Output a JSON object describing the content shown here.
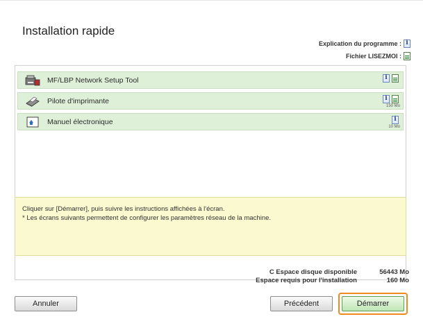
{
  "title": "Installation rapide",
  "legend": {
    "program_explanation": "Explication du programme :",
    "readme_file": "Fichier LISEZMOI :"
  },
  "icons": {
    "info": "info-icon",
    "readme": "readme-doc-icon"
  },
  "components": [
    {
      "label": "MF/LBP Network Setup Tool",
      "icon": "network-tool-icon",
      "size": ""
    },
    {
      "label": "Pilote d'imprimante",
      "icon": "printer-icon",
      "size": "150 Mo"
    },
    {
      "label": "Manuel électronique",
      "icon": "manual-icon",
      "size": "10 Mo"
    }
  ],
  "message": {
    "line1": "Cliquer sur [Démarrer], puis suivre les instructions affichées à l'écran.",
    "line2": "* Les écrans suivants permettent de configurer les paramètres réseau de la machine."
  },
  "disk": {
    "available_label": "C Espace disque disponible",
    "available_value": "56443 Mo",
    "required_label": "Espace requis pour l'installation",
    "required_value": "160 Mo"
  },
  "buttons": {
    "cancel": "Annuler",
    "previous": "Précédent",
    "start": "Démarrer"
  },
  "colors": {
    "row_bg": "#dff0d8",
    "message_bg": "#fbf9cf",
    "highlight": "#f08a1c"
  }
}
